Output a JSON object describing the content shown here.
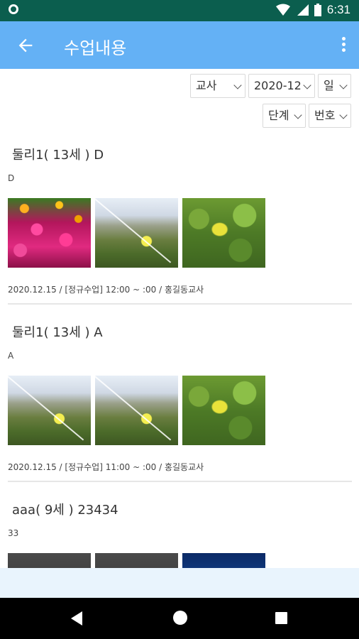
{
  "status_bar": {
    "time": "6:31"
  },
  "app_bar": {
    "title": "수업내용"
  },
  "filters": {
    "teacher": "교사",
    "month": "2020-12",
    "day": "일",
    "level": "단계",
    "number": "번호"
  },
  "lessons": [
    {
      "title": "둘리1( 13세 ) D",
      "description": "D",
      "meta": "2020.12.15  / [정규수업]  12:00  ~  :00  / 홍길동교사"
    },
    {
      "title": "둘리1( 13세 ) A",
      "description": "A",
      "meta": "2020.12.15  / [정규수업]  11:00  ~  :00  / 홍길동교사"
    },
    {
      "title": "aaa( 9세 ) 23434",
      "description": "33",
      "meta": ""
    }
  ],
  "icons": {
    "back": "arrow-left-icon",
    "more": "more-vertical-icon"
  }
}
